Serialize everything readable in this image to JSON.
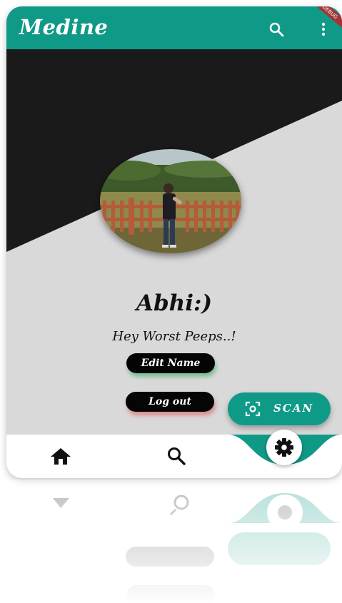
{
  "app": {
    "title": "Medine",
    "debug_ribbon": "DEBUG",
    "colors": {
      "primary": "#0f9a88",
      "dark_bg": "#1a1a1a",
      "light_bg": "#d9d9d9",
      "pill": "#050505"
    }
  },
  "appbar": {
    "search_icon": "search-icon",
    "menu_icon": "more-vert-icon"
  },
  "profile": {
    "name": "Abhi:)",
    "status": "Hey Worst Peeps..!",
    "edit_label": "Edit Name",
    "logout_label": "Log out"
  },
  "scan": {
    "label": "SCAN",
    "icon": "scan-frame-icon"
  },
  "navbar": {
    "items": [
      {
        "icon": "home-icon"
      },
      {
        "icon": "search-icon"
      },
      {
        "icon": "gear-icon",
        "selected": true
      }
    ]
  }
}
